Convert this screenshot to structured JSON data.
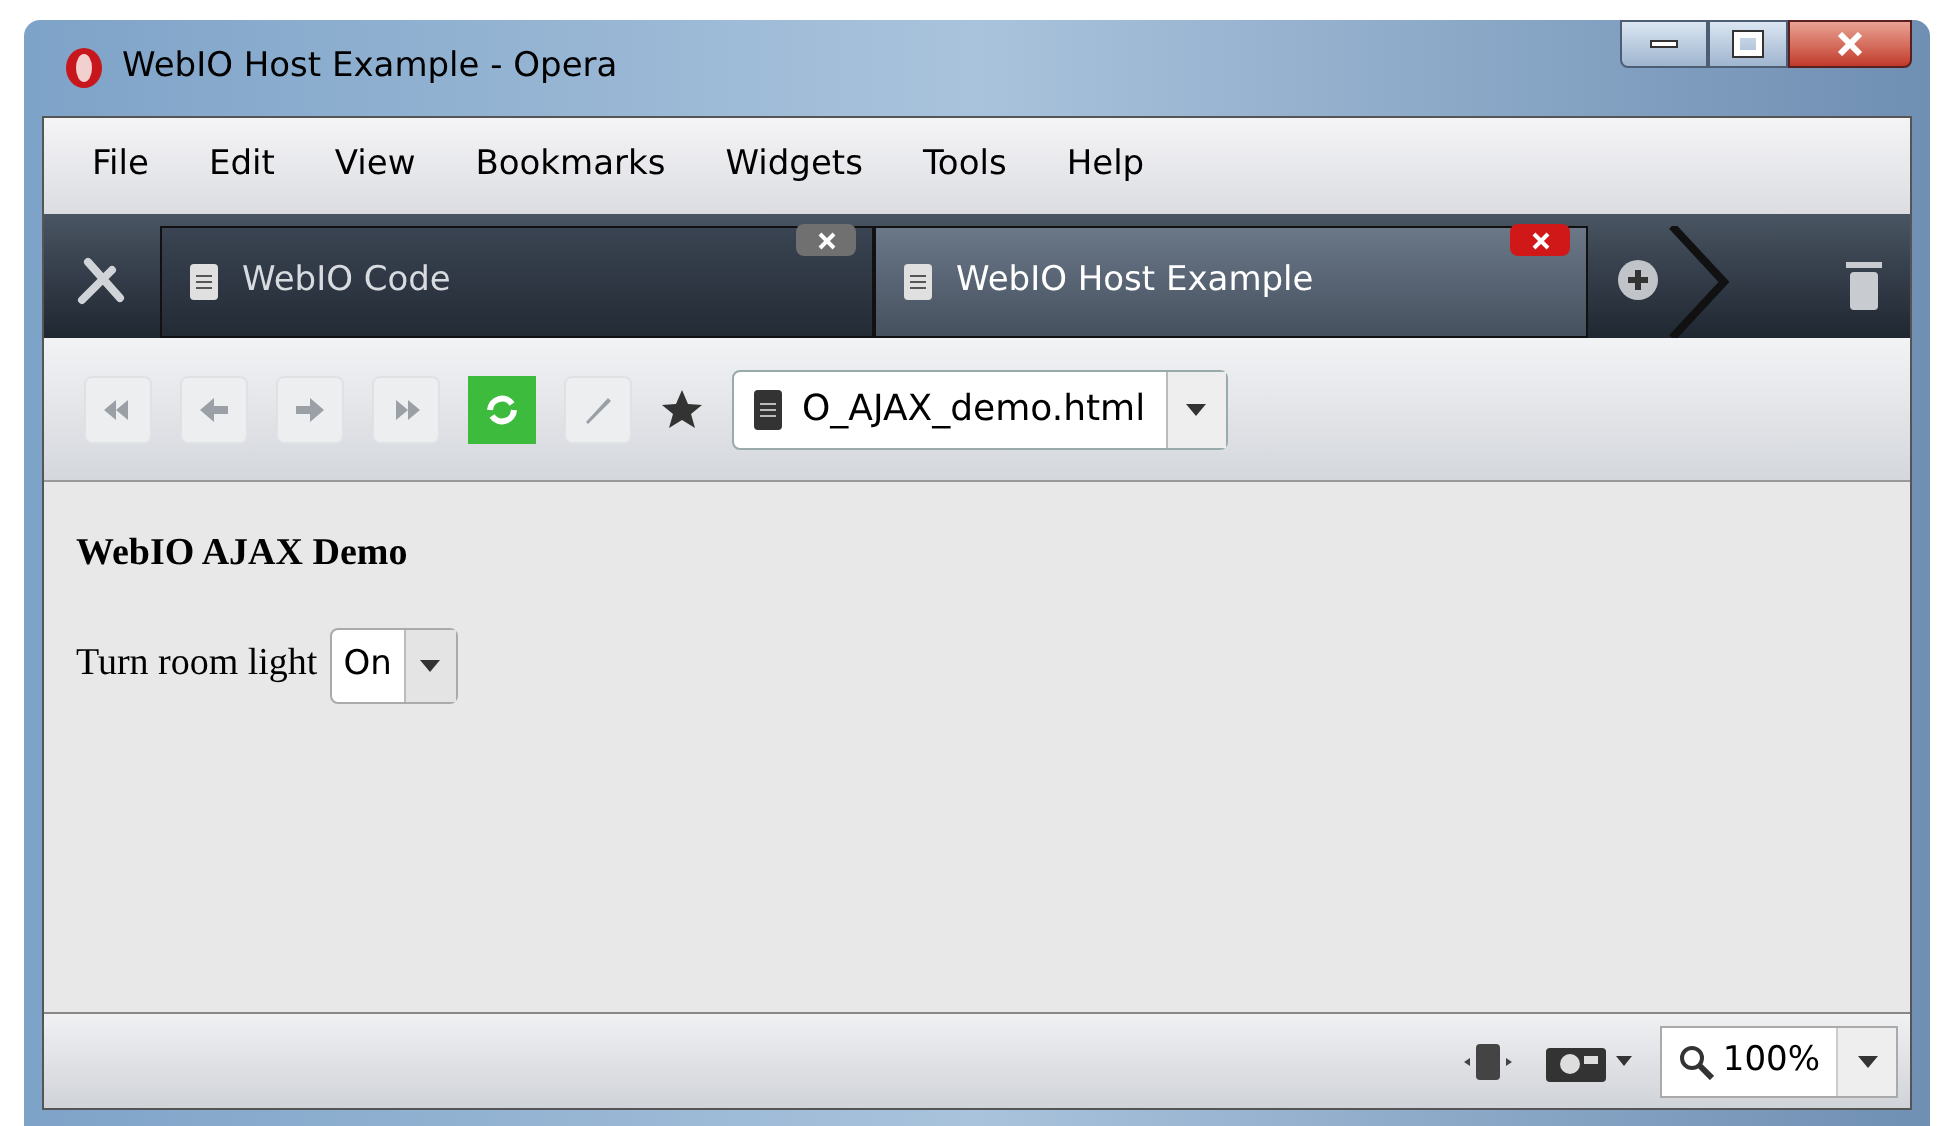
{
  "window": {
    "title": "WebIO Host Example - Opera"
  },
  "menu": [
    "File",
    "Edit",
    "View",
    "Bookmarks",
    "Widgets",
    "Tools",
    "Help"
  ],
  "tabs": [
    {
      "label": "WebIO Code",
      "selected": false
    },
    {
      "label": "WebIO Host Example",
      "selected": true
    }
  ],
  "address": {
    "value": "O_AJAX_demo.html"
  },
  "page": {
    "heading": "WebIO AJAX Demo",
    "label": "Turn room light",
    "select": "On"
  },
  "status_bar": {
    "zoom": "100%"
  }
}
